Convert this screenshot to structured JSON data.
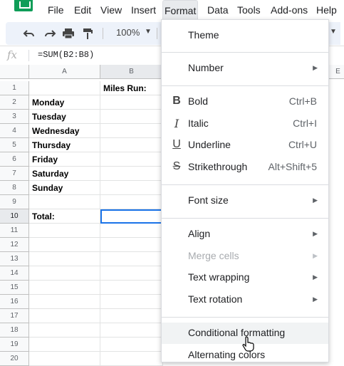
{
  "menubar": {
    "items": [
      "File",
      "Edit",
      "View",
      "Insert",
      "Format",
      "Data",
      "Tools",
      "Add-ons",
      "Help"
    ]
  },
  "toolbar": {
    "zoom": "100%"
  },
  "formula_bar": {
    "fx_label": "fx",
    "formula": "=SUM(B2:B8)"
  },
  "grid": {
    "columns": [
      "A",
      "B",
      "E"
    ],
    "rows": [
      {
        "n": "1",
        "a": "",
        "b": "Miles Run:"
      },
      {
        "n": "2",
        "a": "Monday",
        "b": ""
      },
      {
        "n": "3",
        "a": "Tuesday",
        "b": ""
      },
      {
        "n": "4",
        "a": "Wednesday",
        "b": ""
      },
      {
        "n": "5",
        "a": "Thursday",
        "b": ""
      },
      {
        "n": "6",
        "a": "Friday",
        "b": ""
      },
      {
        "n": "7",
        "a": "Saturday",
        "b": ""
      },
      {
        "n": "8",
        "a": "Sunday",
        "b": ""
      },
      {
        "n": "9",
        "a": "",
        "b": ""
      },
      {
        "n": "10",
        "a": "Total:",
        "b": ""
      },
      {
        "n": "11",
        "a": "",
        "b": ""
      },
      {
        "n": "12",
        "a": "",
        "b": ""
      },
      {
        "n": "13",
        "a": "",
        "b": ""
      },
      {
        "n": "14",
        "a": "",
        "b": ""
      },
      {
        "n": "15",
        "a": "",
        "b": ""
      },
      {
        "n": "16",
        "a": "",
        "b": ""
      },
      {
        "n": "17",
        "a": "",
        "b": ""
      },
      {
        "n": "18",
        "a": "",
        "b": ""
      },
      {
        "n": "19",
        "a": "",
        "b": ""
      },
      {
        "n": "20",
        "a": "",
        "b": ""
      }
    ]
  },
  "format_menu": {
    "theme": "Theme",
    "number": "Number",
    "bold": "Bold",
    "bold_shortcut": "Ctrl+B",
    "italic": "Italic",
    "italic_shortcut": "Ctrl+I",
    "underline": "Underline",
    "underline_shortcut": "Ctrl+U",
    "strikethrough": "Strikethrough",
    "strikethrough_shortcut": "Alt+Shift+5",
    "font_size": "Font size",
    "align": "Align",
    "merge_cells": "Merge cells",
    "text_wrapping": "Text wrapping",
    "text_rotation": "Text rotation",
    "conditional_formatting": "Conditional formatting",
    "alternating_colors": "Alternating colors"
  },
  "colors": {
    "accent": "#1a73e8",
    "brand": "#0f9d58"
  }
}
